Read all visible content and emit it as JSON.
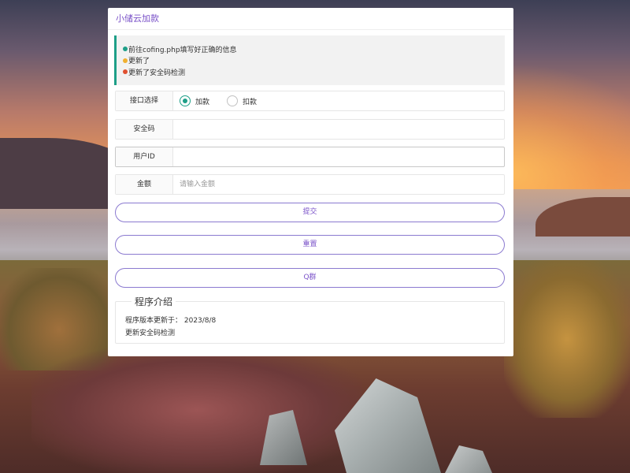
{
  "app": {
    "title": "小储云加款",
    "accent_color": "#7a52c8",
    "success_color": "#1e9f88"
  },
  "notice": {
    "lines": [
      {
        "text": "前往cofing.php填写好正确的信息",
        "dot_color": "#1e9f88"
      },
      {
        "text": "更新了",
        "dot_color": "#f0b030"
      },
      {
        "text": "更新了安全码检测",
        "dot_color": "#e05030"
      }
    ]
  },
  "form": {
    "interface": {
      "label": "接口选择",
      "options": [
        {
          "label": "加款",
          "checked": true
        },
        {
          "label": "扣款",
          "checked": false
        }
      ]
    },
    "security_code": {
      "label": "安全码",
      "value": "",
      "placeholder": ""
    },
    "user_id": {
      "label": "用户ID",
      "value": "",
      "placeholder": ""
    },
    "amount": {
      "label": "金额",
      "value": "",
      "placeholder": "请输入金额"
    }
  },
  "buttons": {
    "submit": "提交",
    "reset": "重置",
    "qq_group": "Q群"
  },
  "intro": {
    "legend": "程序介绍",
    "version_line": "程序版本更新于： 2023/8/8",
    "desc_line": "更新安全码检测"
  }
}
